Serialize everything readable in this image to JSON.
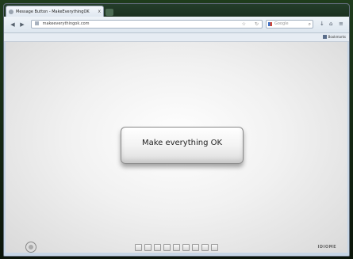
{
  "window": {
    "tab_title": "Message Button - MakeEverythingOK",
    "tab_close": "x",
    "url": "makeeverythingok.com"
  },
  "toolbar": {
    "back": "◀",
    "forward": "▶",
    "star": "☆",
    "reload": "↻",
    "search_placeholder": "Google",
    "search_icon": "⌕",
    "download": "↓",
    "home": "⌂",
    "menu": "≡"
  },
  "bookmarks": {
    "label": "Bookmarks"
  },
  "page": {
    "button_label": "Make everything OK",
    "credit": "IDIOME"
  }
}
